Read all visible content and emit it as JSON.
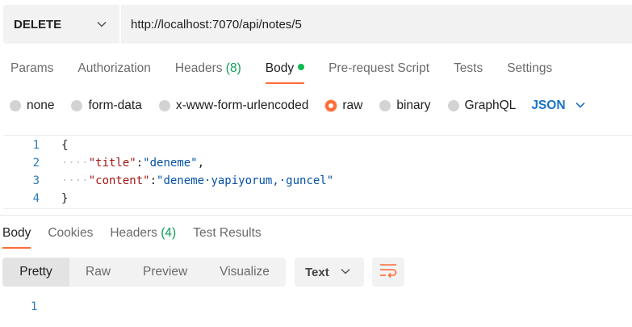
{
  "request": {
    "method": "DELETE",
    "url": "http://localhost:7070/api/notes/5"
  },
  "request_tabs": [
    {
      "label": "Params"
    },
    {
      "label": "Authorization"
    },
    {
      "label": "Headers",
      "count": "(8)"
    },
    {
      "label": "Body",
      "active": true
    },
    {
      "label": "Pre-request Script"
    },
    {
      "label": "Tests"
    },
    {
      "label": "Settings"
    }
  ],
  "body_types": [
    {
      "label": "none"
    },
    {
      "label": "form-data"
    },
    {
      "label": "x-www-form-urlencoded"
    },
    {
      "label": "raw",
      "selected": true
    },
    {
      "label": "binary"
    },
    {
      "label": "GraphQL"
    }
  ],
  "body_format": "JSON",
  "editor": {
    "line_numbers": [
      "1",
      "2",
      "3",
      "4"
    ],
    "open_brace": "{",
    "close_brace": "}",
    "indent": "····",
    "title_key": "\"title\"",
    "title_value": "\"deneme\"",
    "content_key": "\"content\"",
    "content_value": "\"deneme·yapiyorum,·guncel\"",
    "colon": ":",
    "comma": ","
  },
  "response_tabs": [
    {
      "label": "Body",
      "active": true
    },
    {
      "label": "Cookies"
    },
    {
      "label": "Headers",
      "count": "(4)"
    },
    {
      "label": "Test Results"
    }
  ],
  "view_modes": [
    "Pretty",
    "Raw",
    "Preview",
    "Visualize"
  ],
  "response_format": "Text",
  "response_line_number": "1",
  "colors": {
    "accent": "#ff6c37",
    "count_green": "#0f9d58",
    "json_blue": "#1a73c8"
  }
}
